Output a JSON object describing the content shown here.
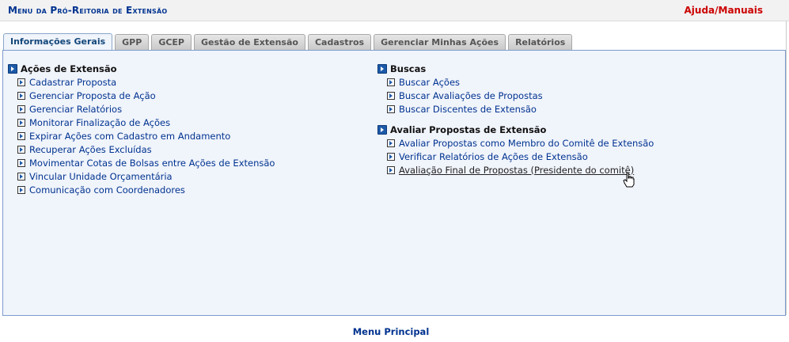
{
  "header": {
    "title": "Menu da Pró-Reitoria de Extensão",
    "help_link": "Ajuda/Manuais"
  },
  "tabs": [
    {
      "label": "Informações Gerais",
      "active": true
    },
    {
      "label": "GPP",
      "active": false
    },
    {
      "label": "GCEP",
      "active": false
    },
    {
      "label": "Gestão de Extensão",
      "active": false
    },
    {
      "label": "Cadastros",
      "active": false
    },
    {
      "label": "Gerenciar Minhas Ações",
      "active": false
    },
    {
      "label": "Relatórios",
      "active": false
    }
  ],
  "sections": {
    "acoes": {
      "title": "Ações de Extensão",
      "items": [
        "Cadastrar Proposta",
        "Gerenciar Proposta de Ação",
        "Gerenciar Relatórios",
        "Monitorar Finalização de Ações",
        "Expirar Ações com Cadastro em Andamento",
        "Recuperar Ações Excluídas",
        "Movimentar Cotas de Bolsas entre Ações de Extensão",
        "Vincular Unidade Orçamentária",
        "Comunicação com Coordenadores"
      ]
    },
    "buscas": {
      "title": "Buscas",
      "items": [
        "Buscar Ações",
        "Buscar Avaliações de Propostas",
        "Buscar Discentes de Extensão"
      ]
    },
    "avaliar": {
      "title": "Avaliar Propostas de Extensão",
      "items": [
        "Avaliar Propostas como Membro do Comitê de Extensão",
        "Verificar Relatórios de Ações de Extensão",
        "Avaliação Final de Propostas (Presidente do comitê)"
      ]
    }
  },
  "footer": {
    "link": "Menu Principal"
  },
  "colors": {
    "link": "#003390",
    "help": "#cc0000",
    "panel_bg": "#f0f4fb",
    "panel_border": "#7c9ccc"
  }
}
